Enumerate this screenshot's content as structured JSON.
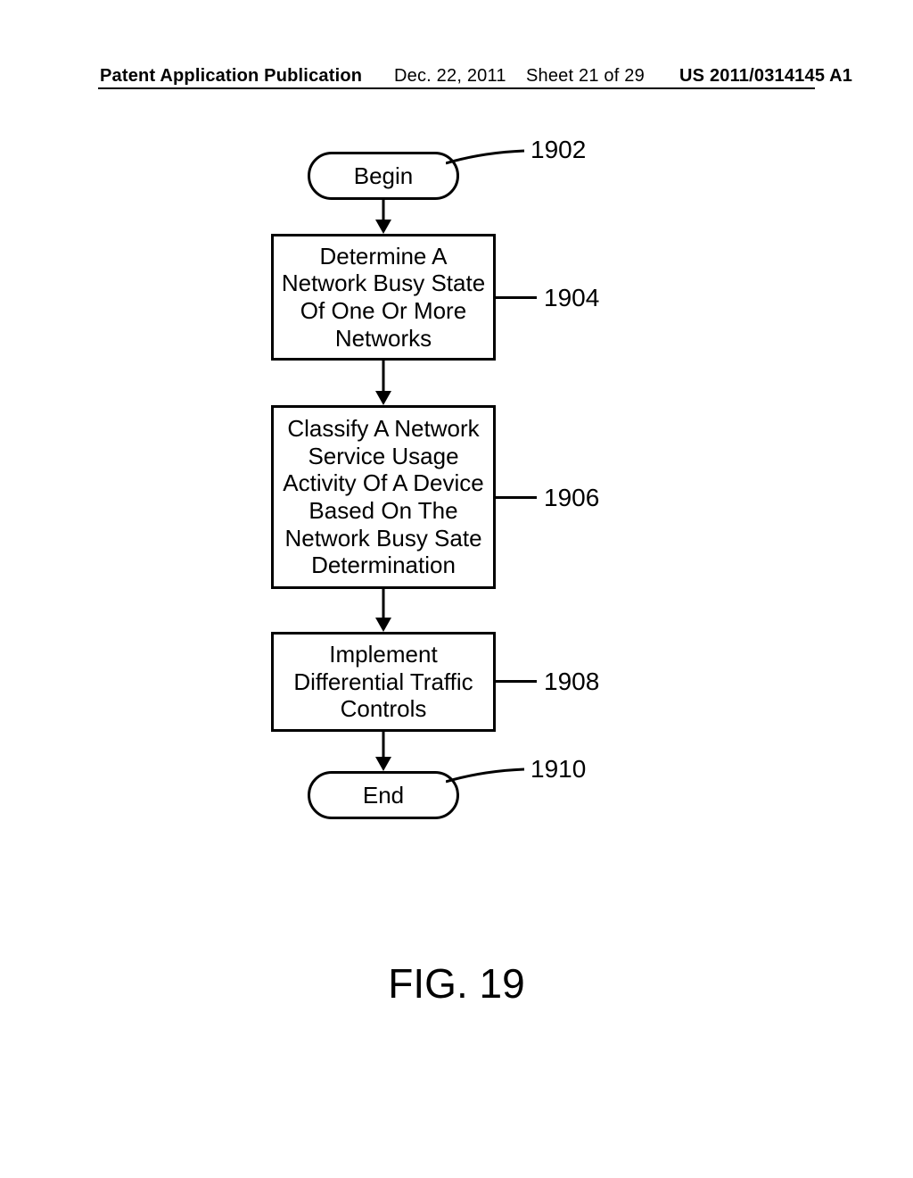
{
  "header": {
    "publication": "Patent Application Publication",
    "date": "Dec. 22, 2011",
    "sheet": "Sheet 21 of 29",
    "appno": "US 2011/0314145 A1"
  },
  "flow": {
    "begin": "Begin",
    "step1": "Determine A\nNetwork Busy State\nOf One Or More\nNetworks",
    "step2": "Classify A Network\nService Usage\nActivity Of A Device\nBased On The\nNetwork Busy Sate\nDetermination",
    "step3": "Implement\nDifferential Traffic\nControls",
    "end": "End"
  },
  "refs": {
    "r1902": "1902",
    "r1904": "1904",
    "r1906": "1906",
    "r1908": "1908",
    "r1910": "1910"
  },
  "figure": "FIG. 19"
}
